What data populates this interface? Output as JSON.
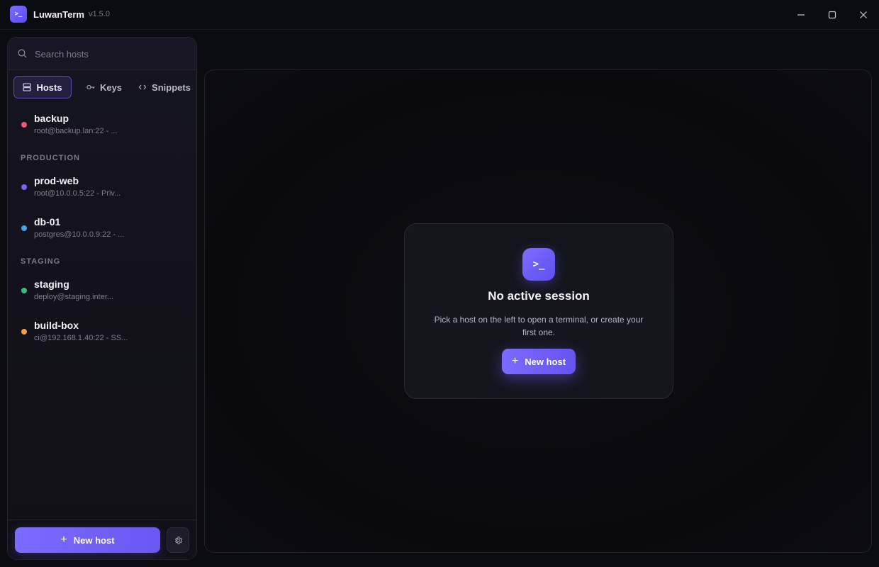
{
  "app": {
    "name": "LuwanTerm",
    "version": "v1.5.0",
    "logo_glyph": ">_",
    "accent": "#7b6bff"
  },
  "window_controls": {
    "minimize_icon": "minimize-icon",
    "maximize_icon": "maximize-icon",
    "close_icon": "close-icon"
  },
  "sidebar": {
    "search": {
      "placeholder": "Search hosts",
      "value": ""
    },
    "tabs": [
      {
        "label": "Hosts",
        "icon": "server-icon",
        "active": true
      },
      {
        "label": "Keys",
        "icon": "key-icon",
        "active": false
      },
      {
        "label": "Snippets",
        "icon": "code-icon",
        "active": false
      }
    ],
    "ungrouped_hosts": [
      {
        "name": "backup",
        "detail": "root@backup.lan:22 - ...",
        "color": "#f0577a"
      }
    ],
    "groups": [
      {
        "label": "PRODUCTION",
        "hosts": [
          {
            "name": "prod-web",
            "detail": "root@10.0.0.5:22 - Priv...",
            "color": "#7f63f5"
          },
          {
            "name": "db-01",
            "detail": "postgres@10.0.0.9:22 - ...",
            "color": "#3aa6f0"
          }
        ]
      },
      {
        "label": "STAGING",
        "hosts": [
          {
            "name": "staging",
            "detail": "deploy@staging.inter...",
            "color": "#2fc27e"
          },
          {
            "name": "build-box",
            "detail": "ci@192.168.1.40:22 - SS...",
            "color": "#f2a33c"
          }
        ]
      }
    ],
    "footer": {
      "new_host_label": "New host",
      "settings_icon": "gear-icon"
    }
  },
  "main": {
    "empty_state": {
      "icon_glyph": ">_",
      "title": "No active session",
      "description": "Pick a host on the left to open a terminal, or create your first one.",
      "button_label": "New host"
    }
  }
}
